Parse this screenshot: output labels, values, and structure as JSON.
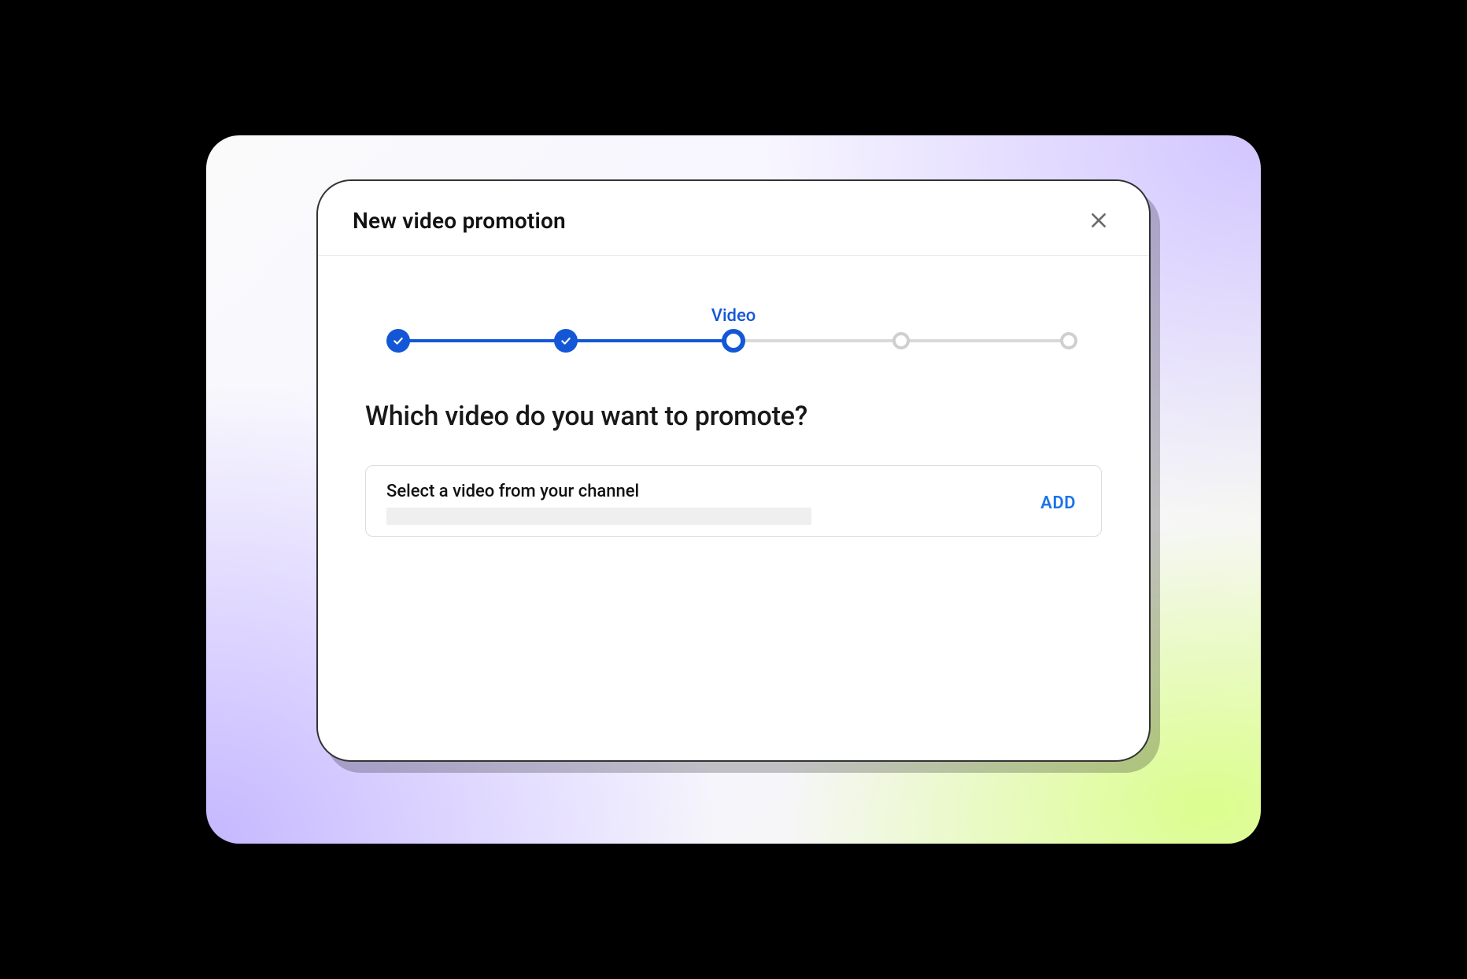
{
  "dialog": {
    "title": "New video promotion",
    "question": "Which video do you want to promote?",
    "stepper": {
      "current_label": "Video",
      "steps": [
        {
          "state": "complete"
        },
        {
          "state": "complete"
        },
        {
          "state": "current",
          "label": "Video"
        },
        {
          "state": "upcoming"
        },
        {
          "state": "upcoming"
        }
      ]
    },
    "video_select": {
      "label": "Select a video from your channel",
      "value": "",
      "add_button": "ADD"
    }
  },
  "colors": {
    "primary": "#1457d6",
    "link": "#1a73e8",
    "muted_track": "#d9d9d9"
  }
}
